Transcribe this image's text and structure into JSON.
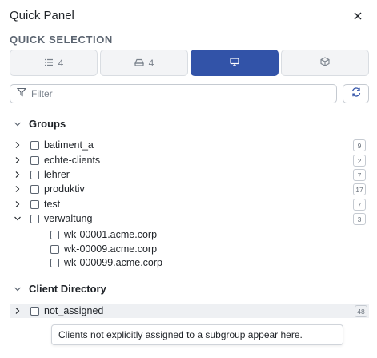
{
  "panel": {
    "title": "Quick Panel"
  },
  "quick_selection": {
    "label": "QUICK SELECTION",
    "tabs": [
      {
        "icon": "list-icon",
        "count": "4",
        "active": false
      },
      {
        "icon": "drive-icon",
        "count": "4",
        "active": false
      },
      {
        "icon": "monitor-icon",
        "count": "",
        "active": true
      },
      {
        "icon": "cube-icon",
        "count": "",
        "active": false
      }
    ]
  },
  "filter": {
    "placeholder": "Filter",
    "value": ""
  },
  "groups": {
    "label": "Groups",
    "items": [
      {
        "name": "batiment_a",
        "count": "9",
        "expanded": false
      },
      {
        "name": "echte-clients",
        "count": "2",
        "expanded": false
      },
      {
        "name": "lehrer",
        "count": "7",
        "expanded": false
      },
      {
        "name": "produktiv",
        "count": "17",
        "expanded": false
      },
      {
        "name": "test",
        "count": "7",
        "expanded": false
      },
      {
        "name": "verwaltung",
        "count": "3",
        "expanded": true,
        "children": [
          "wk-00001.acme.corp",
          "wk-00009.acme.corp",
          "wk-000099.acme.corp"
        ]
      }
    ]
  },
  "client_directory": {
    "label": "Client Directory",
    "items": [
      {
        "name": "not_assigned",
        "count": "48"
      }
    ]
  },
  "tooltip": {
    "text": "Clients not explicitly assigned to a subgroup appear here."
  },
  "colors": {
    "accent": "#3253a8",
    "border": "#d9dde2",
    "muted": "#5b6470"
  }
}
